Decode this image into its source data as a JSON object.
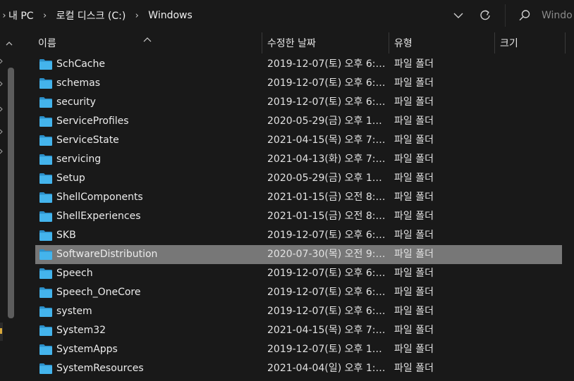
{
  "address": {
    "breadcrumbs": [
      "내 PC",
      "로컬 디스크 (C:)",
      "Windows"
    ],
    "search_placeholder": "Windo"
  },
  "columns": {
    "name": "이름",
    "modified": "수정한 날짜",
    "type": "유형",
    "size": "크기"
  },
  "files": [
    {
      "name": "SchCache",
      "modified": "2019-12-07(토) 오후 6:…",
      "type": "파일 폴더",
      "size": ""
    },
    {
      "name": "schemas",
      "modified": "2019-12-07(토) 오후 6:…",
      "type": "파일 폴더",
      "size": ""
    },
    {
      "name": "security",
      "modified": "2019-12-07(토) 오후 6:…",
      "type": "파일 폴더",
      "size": ""
    },
    {
      "name": "ServiceProfiles",
      "modified": "2020-05-29(금) 오후 1…",
      "type": "파일 폴더",
      "size": ""
    },
    {
      "name": "ServiceState",
      "modified": "2021-04-15(목) 오후 7:…",
      "type": "파일 폴더",
      "size": ""
    },
    {
      "name": "servicing",
      "modified": "2021-04-13(화) 오후 7:…",
      "type": "파일 폴더",
      "size": ""
    },
    {
      "name": "Setup",
      "modified": "2020-05-29(금) 오후 1…",
      "type": "파일 폴더",
      "size": ""
    },
    {
      "name": "ShellComponents",
      "modified": "2021-01-15(금) 오전 8:…",
      "type": "파일 폴더",
      "size": ""
    },
    {
      "name": "ShellExperiences",
      "modified": "2021-01-15(금) 오전 8:…",
      "type": "파일 폴더",
      "size": ""
    },
    {
      "name": "SKB",
      "modified": "2019-12-07(토) 오후 6:…",
      "type": "파일 폴더",
      "size": ""
    },
    {
      "name": "SoftwareDistribution",
      "modified": "2020-07-30(목) 오전 9:…",
      "type": "파일 폴더",
      "size": "",
      "selected": true
    },
    {
      "name": "Speech",
      "modified": "2019-12-07(토) 오후 6:…",
      "type": "파일 폴더",
      "size": ""
    },
    {
      "name": "Speech_OneCore",
      "modified": "2019-12-07(토) 오후 6:…",
      "type": "파일 폴더",
      "size": ""
    },
    {
      "name": "system",
      "modified": "2019-12-07(토) 오후 6:…",
      "type": "파일 폴더",
      "size": ""
    },
    {
      "name": "System32",
      "modified": "2021-04-15(목) 오후 7:…",
      "type": "파일 폴더",
      "size": ""
    },
    {
      "name": "SystemApps",
      "modified": "2019-12-07(토) 오후 1…",
      "type": "파일 폴더",
      "size": ""
    },
    {
      "name": "SystemResources",
      "modified": "2021-04-04(일) 오후 1:…",
      "type": "파일 폴더",
      "size": ""
    }
  ],
  "colors": {
    "background": "#191919",
    "selected_row": "#777777",
    "folder": "#3fb0e8"
  },
  "icons": {
    "breadcrumb_separator": "chevron-right-icon",
    "dropdown": "chevron-down-icon",
    "refresh": "refresh-icon",
    "search": "search-icon",
    "folder": "folder-icon",
    "sort": "sort-ascending-icon"
  }
}
